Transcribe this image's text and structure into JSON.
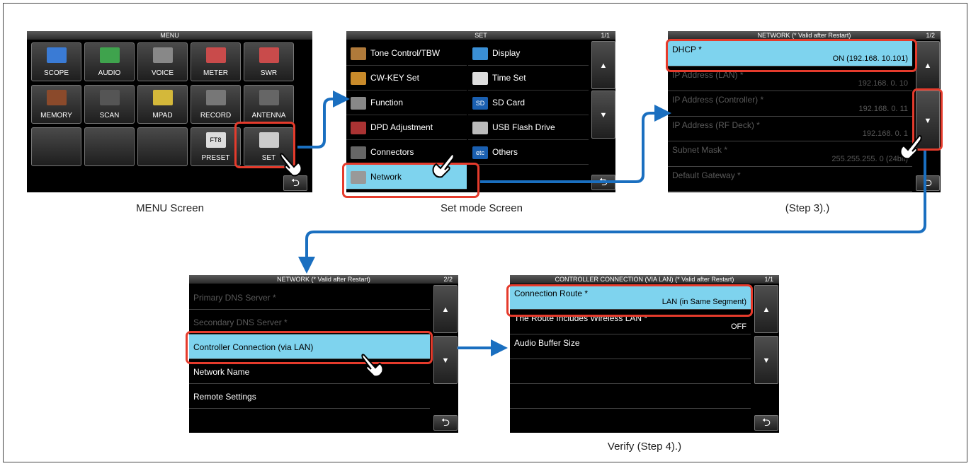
{
  "menu_screen": {
    "title": "MENU",
    "caption": "MENU Screen",
    "buttons": [
      "SCOPE",
      "AUDIO",
      "VOICE",
      "METER",
      "SWR",
      "MEMORY",
      "SCAN",
      "MPAD",
      "RECORD",
      "ANTENNA",
      "",
      "",
      "",
      "PRESET",
      "SET"
    ],
    "preset_badge": "FT8",
    "back_symbol": "⮌"
  },
  "set_screen": {
    "title": "SET",
    "page": "1/1",
    "caption": "Set mode Screen",
    "left_items": [
      "Tone Control/TBW",
      "CW-KEY Set",
      "Function",
      "DPD Adjustment",
      "Connectors",
      "Network"
    ],
    "right_items": [
      "Display",
      "Time Set",
      "SD Card",
      "USB Flash Drive",
      "Others"
    ],
    "sd_badge": "SD",
    "etc_badge": "etc"
  },
  "network1": {
    "title": "NETWORK (* Valid after Restart)",
    "page": "1/2",
    "caption": "(Step 3).)",
    "rows": [
      {
        "label": "DHCP *",
        "value": "ON (192.168.  10.101)"
      },
      {
        "label": "IP Address (LAN) *",
        "value": "192.168.   0. 10"
      },
      {
        "label": "IP Address (Controller) *",
        "value": "192.168.   0. 11"
      },
      {
        "label": "IP Address (RF Deck) *",
        "value": "192.168.   0. 1"
      },
      {
        "label": "Subnet Mask *",
        "value": "255.255.255.   0 (24bit)"
      },
      {
        "label": "Default Gateway *",
        "value": ""
      }
    ]
  },
  "network2": {
    "title": "NETWORK (* Valid after Restart)",
    "page": "2/2",
    "rows": [
      {
        "label": "Primary DNS Server *",
        "value": ""
      },
      {
        "label": "Secondary DNS Server *",
        "value": ""
      },
      {
        "label": "Controller Connection (via LAN)",
        "value": ""
      },
      {
        "label": "Network Name",
        "value": ""
      },
      {
        "label": "Remote Settings",
        "value": ""
      },
      {
        "label": "",
        "value": ""
      }
    ]
  },
  "controller": {
    "title": "CONTROLLER CONNECTION (VIA LAN) (* Valid after Restart)",
    "page": "1/1",
    "caption": "Verify (Step 4).)",
    "rows": [
      {
        "label": "Connection Route *",
        "value": "LAN (in Same Segment)"
      },
      {
        "label": "The Route Includes Wireless LAN *",
        "value": "OFF"
      },
      {
        "label": "Audio Buffer Size",
        "value": ""
      },
      {
        "label": "",
        "value": ""
      },
      {
        "label": "",
        "value": ""
      },
      {
        "label": "",
        "value": ""
      }
    ]
  },
  "colors": {
    "highlight": "#e53b2c",
    "selected": "#7ed3ee",
    "arrow": "#1a6fc0"
  }
}
